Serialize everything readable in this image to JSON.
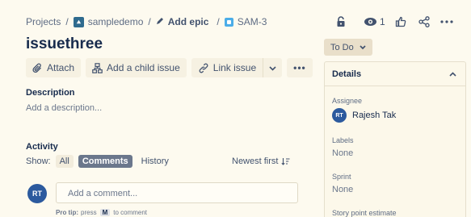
{
  "breadcrumb": {
    "items": [
      "Projects",
      "sampledemo",
      "Add epic",
      "SAM-3"
    ],
    "separator": "/"
  },
  "header": {
    "watch_count": "1",
    "icons": [
      "lock-icon",
      "eye-icon",
      "thumbs-up-icon",
      "share-icon",
      "more-icon"
    ]
  },
  "issue": {
    "title": "issuethree",
    "status": "To Do"
  },
  "actions": {
    "attach": "Attach",
    "add_child": "Add a child issue",
    "link_issue": "Link issue",
    "more": "•••"
  },
  "description": {
    "label": "Description",
    "placeholder": "Add a description..."
  },
  "activity": {
    "label": "Activity",
    "show_label": "Show:",
    "filters": [
      "All",
      "Comments",
      "History"
    ],
    "active_filter": "Comments",
    "sort_label": "Newest first",
    "comment_placeholder": "Add a comment...",
    "protip_prefix": "Pro tip:",
    "protip_press": "press",
    "protip_key": "M",
    "protip_suffix": "to comment",
    "user_initials": "RT"
  },
  "details": {
    "title": "Details",
    "assignee_label": "Assignee",
    "assignee_initials": "RT",
    "assignee_name": "Rajesh Tak",
    "labels_label": "Labels",
    "labels_value": "None",
    "sprint_label": "Sprint",
    "sprint_value": "None",
    "story_points_label": "Story point estimate"
  },
  "colors": {
    "background": "#fdfaef",
    "avatar": "#2c5a9e",
    "active_filter": "#6b778c",
    "project_icon": "#2f6b8e",
    "key_icon": "#4bade8"
  }
}
